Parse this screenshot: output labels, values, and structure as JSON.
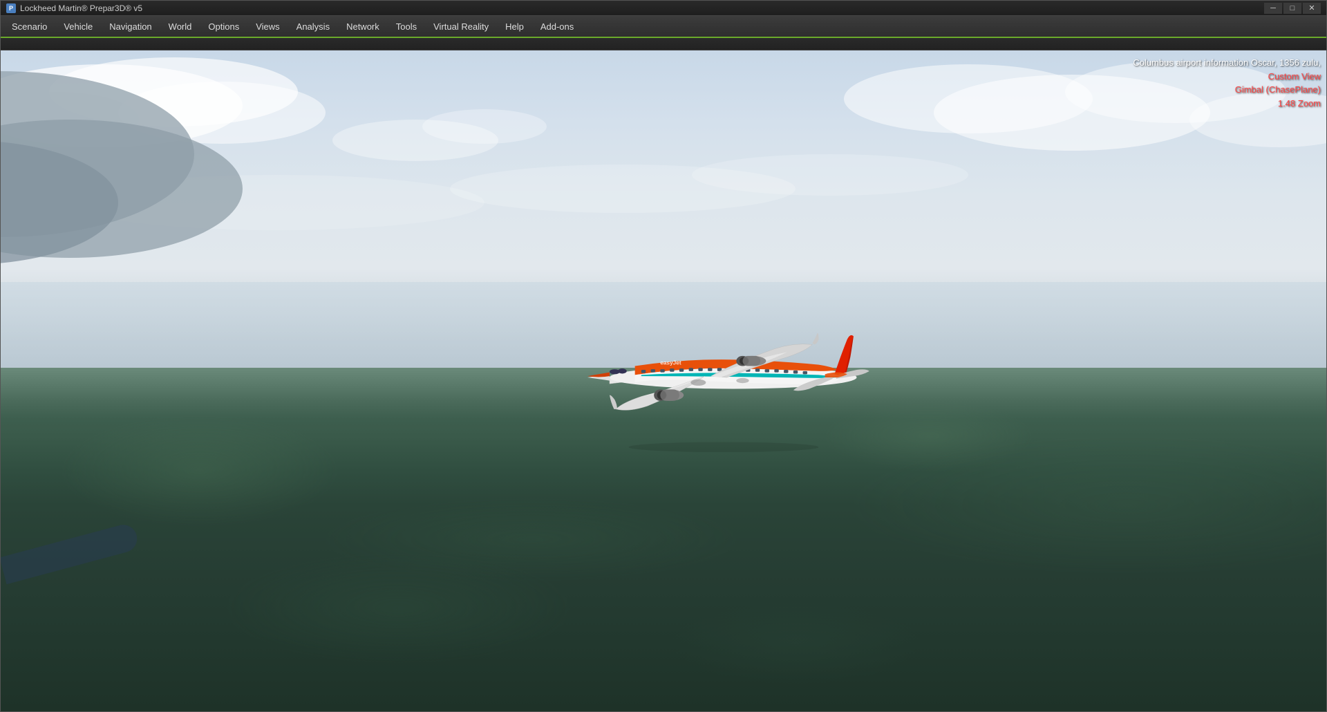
{
  "window": {
    "title": "Lockheed Martin® Prepar3D® v5",
    "icon": "P"
  },
  "titlebar": {
    "minimize": "─",
    "maximize": "□",
    "close": "✕"
  },
  "menubar": {
    "items": [
      {
        "id": "scenario",
        "label": "Scenario"
      },
      {
        "id": "vehicle",
        "label": "Vehicle"
      },
      {
        "id": "navigation",
        "label": "Navigation"
      },
      {
        "id": "world",
        "label": "World"
      },
      {
        "id": "options",
        "label": "Options"
      },
      {
        "id": "views",
        "label": "Views"
      },
      {
        "id": "analysis",
        "label": "Analysis"
      },
      {
        "id": "network",
        "label": "Network"
      },
      {
        "id": "tools",
        "label": "Tools"
      },
      {
        "id": "virtual-reality",
        "label": "Virtual Reality"
      },
      {
        "id": "help",
        "label": "Help"
      },
      {
        "id": "add-ons",
        "label": "Add-ons"
      }
    ]
  },
  "hud": {
    "airport_info": "Columbus airport information Oscar, 1356 zulu,",
    "view_mode": "Custom View",
    "camera_mode": "Gimbal (ChasePlane)",
    "zoom": "1.48 Zoom"
  }
}
